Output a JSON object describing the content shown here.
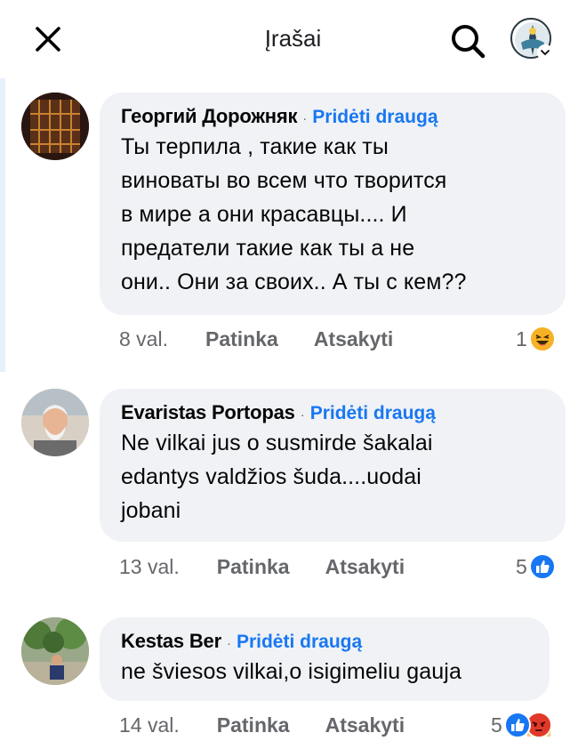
{
  "header": {
    "title": "Įrašai"
  },
  "comments": [
    {
      "author": "Георгий Дорожняк",
      "add_friend": "Pridėti draugą",
      "text_lines": [
        "Ты терпила , такие как ты",
        "виноваты во всем что творится",
        "в мире а они красавцы.... И",
        "предатели такие как ты а не",
        "они.. Они за своих.. А ты с кем??"
      ],
      "time": "8 val.",
      "like_label": "Patinka",
      "reply_label": "Atsakyti",
      "reaction_count": "1",
      "reactions": [
        "haha-icon"
      ]
    },
    {
      "author": "Evaristas Portopas",
      "add_friend": "Pridėti draugą",
      "text_lines": [
        "Ne vilkai jus o susmirde šakalai",
        "edantys valdžios šuda....uodai",
        "jobani"
      ],
      "time": "13 val.",
      "like_label": "Patinka",
      "reply_label": "Atsakyti",
      "reaction_count": "5",
      "reactions": [
        "like-icon"
      ]
    },
    {
      "author": "Kestas Ber",
      "add_friend": "Pridėti draugą",
      "text_lines": [
        "ne šviesos vilkai,o isigimeliu gauja"
      ],
      "time": "14 val.",
      "like_label": "Patinka",
      "reply_label": "Atsakyti",
      "reaction_count": "5",
      "reactions": [
        "like-icon",
        "angry-icon"
      ]
    }
  ],
  "colors": {
    "accent": "#1877f2",
    "bubble": "#f0f2f5",
    "meta_text": "#65676b"
  }
}
